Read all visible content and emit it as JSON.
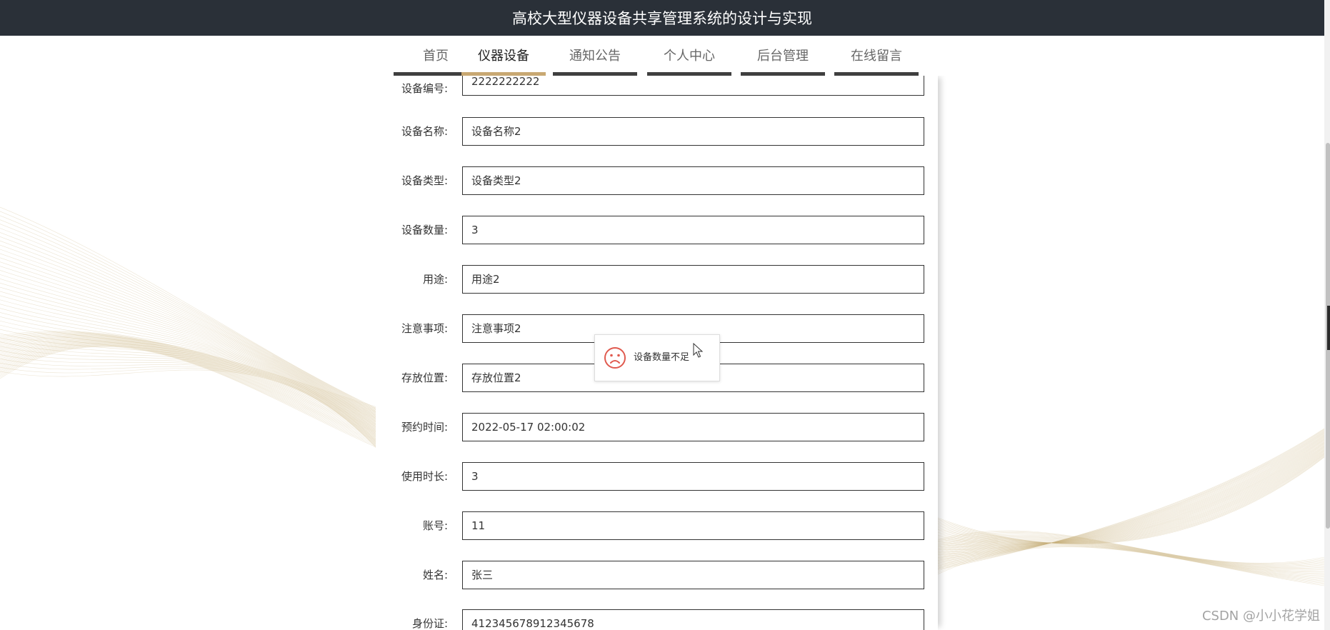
{
  "header": {
    "title": "高校大型仪器设备共享管理系统的设计与实现"
  },
  "nav": {
    "tabs": [
      {
        "label": "首页",
        "active": false
      },
      {
        "label": "仪器设备",
        "active": true
      },
      {
        "label": "通知公告",
        "active": false
      },
      {
        "label": "个人中心",
        "active": false
      },
      {
        "label": "后台管理",
        "active": false
      },
      {
        "label": "在线留言",
        "active": false
      }
    ]
  },
  "form": {
    "fields": [
      {
        "label": "设备编号:",
        "value": "2222222222"
      },
      {
        "label": "设备名称:",
        "value": "设备名称2"
      },
      {
        "label": "设备类型:",
        "value": "设备类型2"
      },
      {
        "label": "设备数量:",
        "value": "3"
      },
      {
        "label": "用途:",
        "value": "用途2"
      },
      {
        "label": "注意事项:",
        "value": "注意事项2"
      },
      {
        "label": "存放位置:",
        "value": "存放位置2"
      },
      {
        "label": "预约时间:",
        "value": "2022-05-17 02:00:02"
      },
      {
        "label": "使用时长:",
        "value": "3"
      },
      {
        "label": "账号:",
        "value": "11"
      },
      {
        "label": "姓名:",
        "value": "张三"
      },
      {
        "label": "身份证:",
        "value": "412345678912345678"
      }
    ]
  },
  "toast": {
    "icon": "sad-face-icon",
    "message": "设备数量不足"
  },
  "watermark": {
    "text": "CSDN @小小花学姐"
  },
  "colors": {
    "header_bg": "#2a3038",
    "nav_active_underline": "#c8a872",
    "nav_inactive_underline": "#3f3f3f",
    "toast_icon": "#e05a4f",
    "wave_line": "#c9b27e"
  }
}
